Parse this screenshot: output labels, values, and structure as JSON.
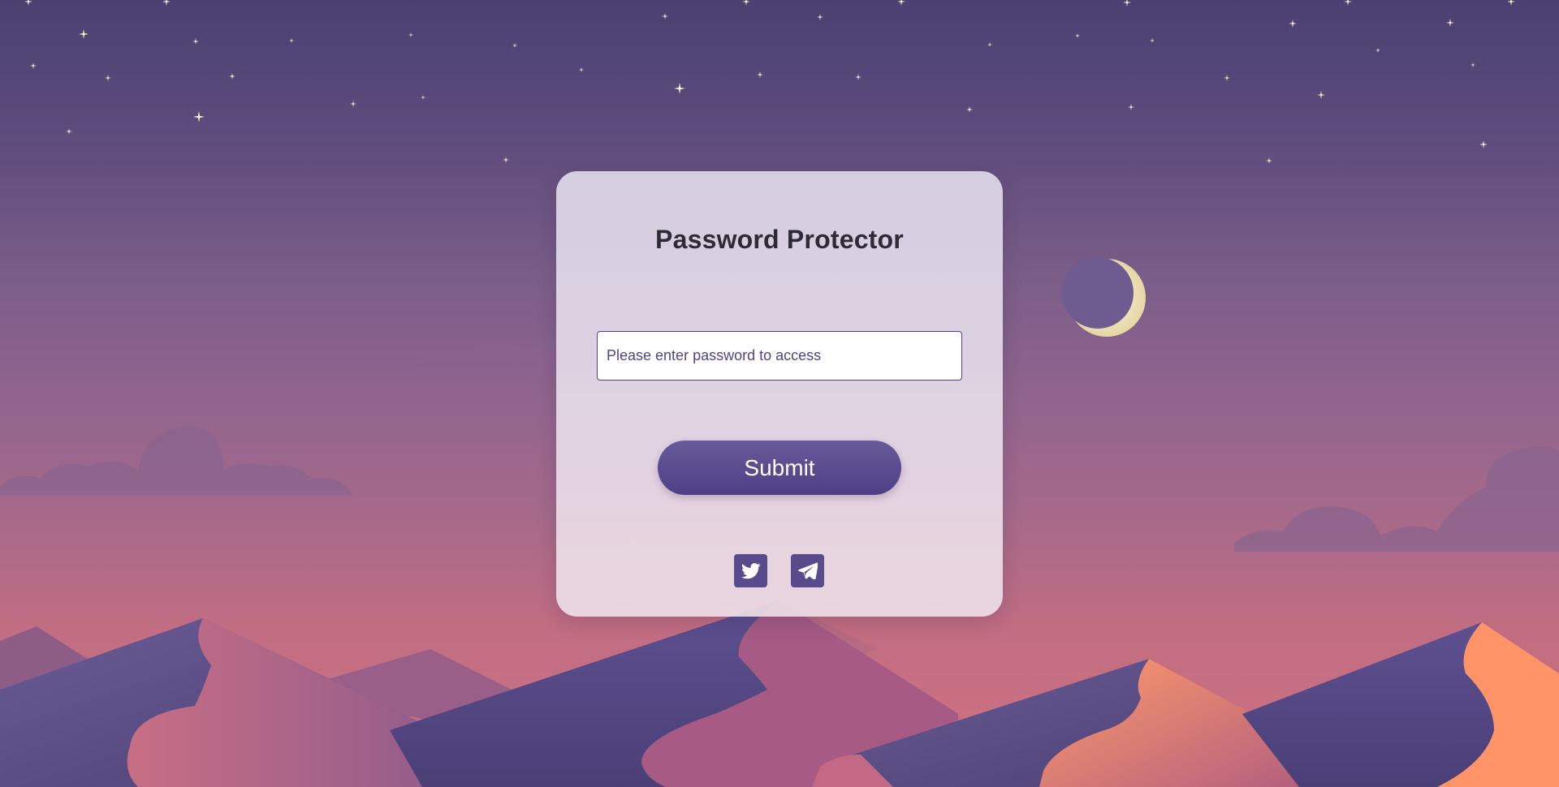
{
  "card": {
    "title": "Password Protector",
    "password_placeholder": "Please enter password to access",
    "password_value": "",
    "submit_label": "Submit"
  },
  "social_links": [
    {
      "name": "twitter",
      "icon": "twitter-icon"
    },
    {
      "name": "telegram",
      "icon": "telegram-icon"
    }
  ],
  "colors": {
    "accent": "#574a8d",
    "title_text": "#2f2b36",
    "sky_top": "#4a4171",
    "sky_bottom": "#cf7281",
    "moon": "#f3e7bf"
  }
}
